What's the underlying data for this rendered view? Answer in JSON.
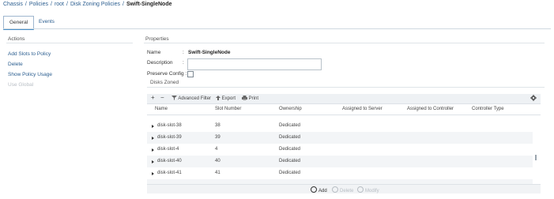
{
  "breadcrumb": {
    "items": [
      "Chassis",
      "Policies",
      "root",
      "Disk Zoning Policies"
    ],
    "current": "Swift-SingleNode",
    "separator": "/"
  },
  "tabs": [
    {
      "label": "General",
      "active": true
    },
    {
      "label": "Events",
      "active": false
    }
  ],
  "actions": {
    "title": "Actions",
    "items": [
      {
        "label": "Add Slots to Policy",
        "enabled": true
      },
      {
        "label": "Delete",
        "enabled": true
      },
      {
        "label": "Show Policy Usage",
        "enabled": true
      },
      {
        "label": "Use Global",
        "enabled": false
      }
    ]
  },
  "properties": {
    "title": "Properties",
    "name_label": "Name",
    "name_separator": ":",
    "name_value": "Swift-SingleNode",
    "description_label": "Description",
    "description_separator": ":",
    "description_value": "",
    "preserve_label": "Preserve Config :",
    "preserve_checked": false,
    "disks_zoned_label": "Disks Zoned"
  },
  "table_toolbar": {
    "add": "+",
    "remove": "−",
    "advanced_filter": "Advanced Filter",
    "export": "Export",
    "print": "Print",
    "settings_icon": "gear-icon"
  },
  "table": {
    "columns": [
      "Name",
      "Slot Number",
      "Ownership",
      "Assigned to Server",
      "Assigned to Controller",
      "Controller Type"
    ],
    "rows": [
      {
        "name": "disk-slot-38",
        "slot": "38",
        "ownership": "Dedicated"
      },
      {
        "name": "disk-slot-39",
        "slot": "39",
        "ownership": "Dedicated"
      },
      {
        "name": "disk-slot-4",
        "slot": "4",
        "ownership": "Dedicated"
      },
      {
        "name": "disk-slot-40",
        "slot": "40",
        "ownership": "Dedicated"
      },
      {
        "name": "disk-slot-41",
        "slot": "41",
        "ownership": "Dedicated"
      }
    ]
  },
  "bottom_actions": {
    "add": "Add",
    "delete": "Delete",
    "modify": "Modify"
  },
  "colors": {
    "link": "#2a5d8f",
    "disabled": "#b8bec4",
    "tab_accent": "#4a90c8"
  }
}
